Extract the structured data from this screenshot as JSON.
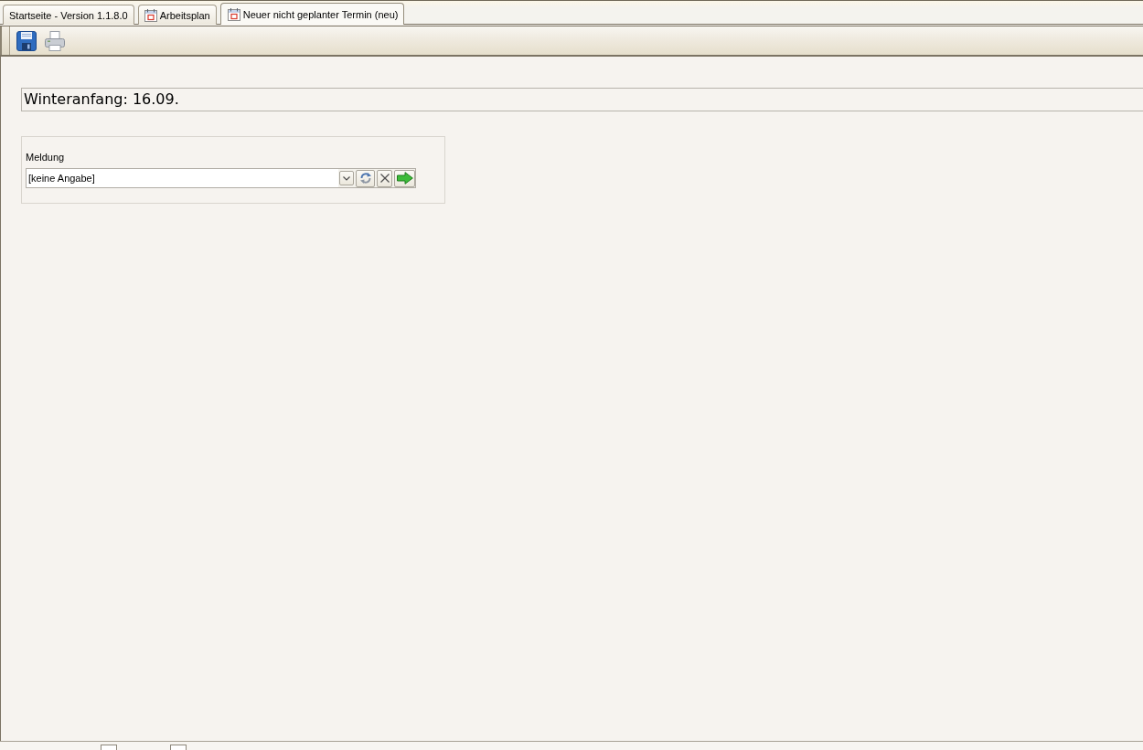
{
  "tabs": [
    {
      "label": "Startseite - Version 1.1.8.0",
      "selected": false,
      "kind": "plain"
    },
    {
      "label": "Arbeitsplan",
      "selected": false,
      "kind": "calendar"
    },
    {
      "label": "Neuer nicht geplanter Termin (neu)",
      "selected": true,
      "kind": "calendar"
    }
  ],
  "toolbar": {
    "buttons": [
      {
        "kind": "save"
      },
      {
        "kind": "print"
      }
    ]
  },
  "header": {
    "title": "Winteranfang: 16.09."
  },
  "message_panel": {
    "label": "Meldung",
    "combo": {
      "value": "[keine Angabe]"
    },
    "buttons": [
      {
        "kind": "dropdown"
      },
      {
        "kind": "refresh"
      },
      {
        "kind": "clear"
      },
      {
        "kind": "go"
      }
    ]
  },
  "status_bar": {
    "fields": [
      {
        "kind": "box"
      },
      {
        "kind": "box"
      }
    ]
  }
}
